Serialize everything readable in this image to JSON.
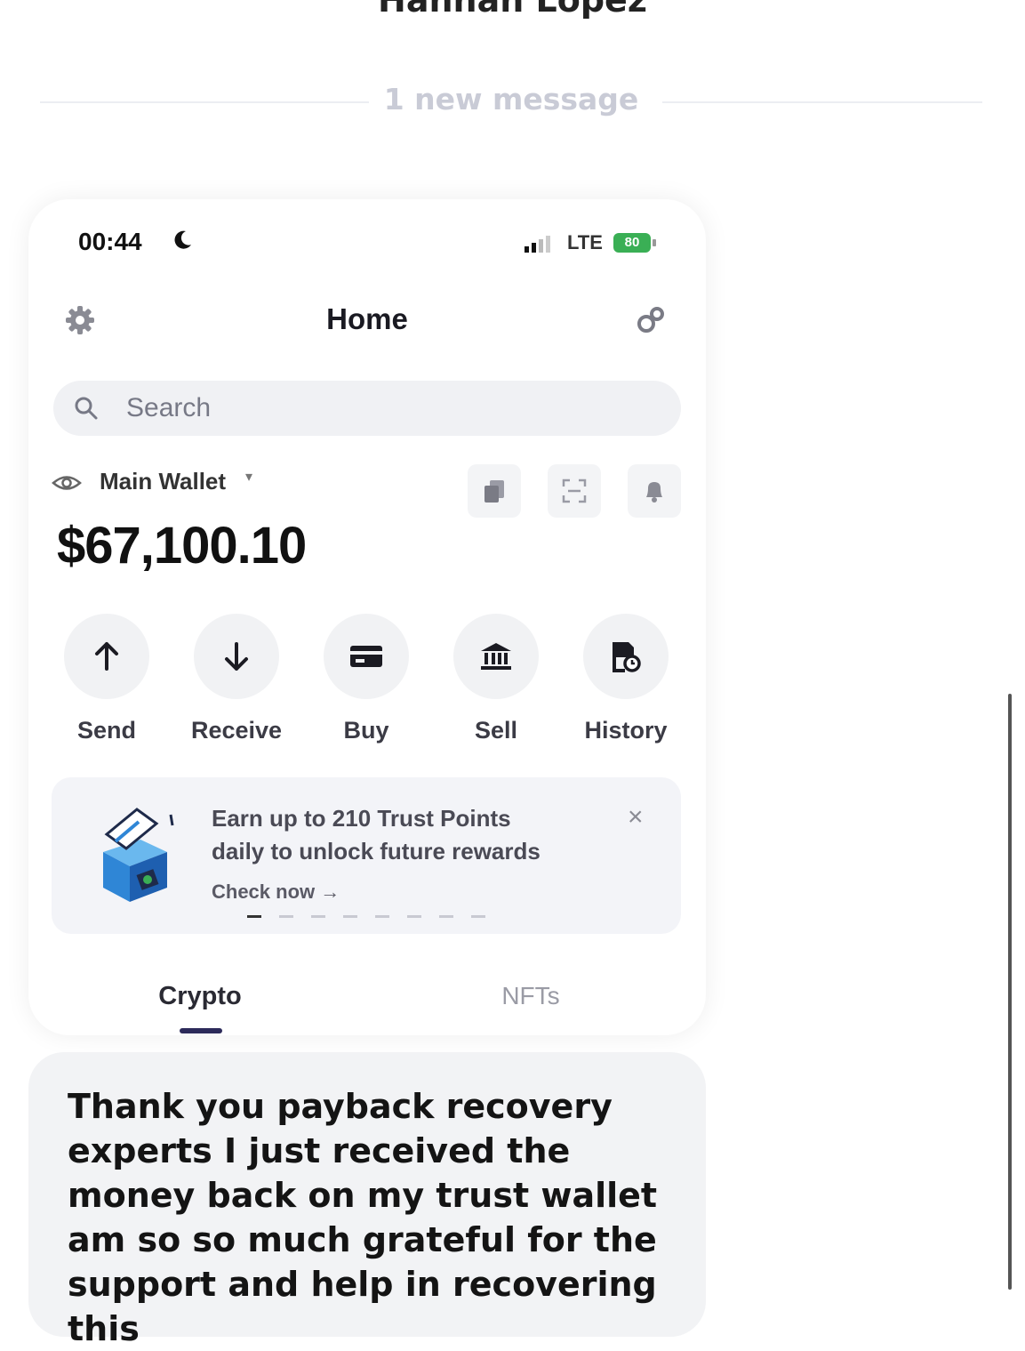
{
  "contact": {
    "name": "Hannah Lopez"
  },
  "divider": {
    "text": "1 new message"
  },
  "phone": {
    "status_bar": {
      "time": "00:44",
      "network": "LTE",
      "battery": "80"
    },
    "header": {
      "title": "Home"
    },
    "search": {
      "placeholder": "Search"
    },
    "wallet": {
      "name": "Main Wallet",
      "caret": "▾",
      "balance": "$67,100.10"
    },
    "actions": [
      {
        "label": "Send",
        "icon": "arrow-up-icon"
      },
      {
        "label": "Receive",
        "icon": "arrow-down-icon"
      },
      {
        "label": "Buy",
        "icon": "card-icon"
      },
      {
        "label": "Sell",
        "icon": "bank-icon"
      },
      {
        "label": "History",
        "icon": "history-icon"
      }
    ],
    "promo": {
      "line1": "Earn up to 210 Trust Points",
      "line2": "daily to unlock future rewards",
      "link": "Check now →",
      "close": "×"
    },
    "tabs": [
      {
        "label": "Crypto",
        "active": true
      },
      {
        "label": "NFTs",
        "active": false
      }
    ]
  },
  "message": {
    "text": "Thank you payback recovery experts I just received the money back on my trust wallet am so so much grateful for the support and help in recovering this"
  },
  "colors": {
    "accent": "#2c2a5a",
    "battery": "#3aaf55",
    "bubble": "#f2f3f5"
  }
}
